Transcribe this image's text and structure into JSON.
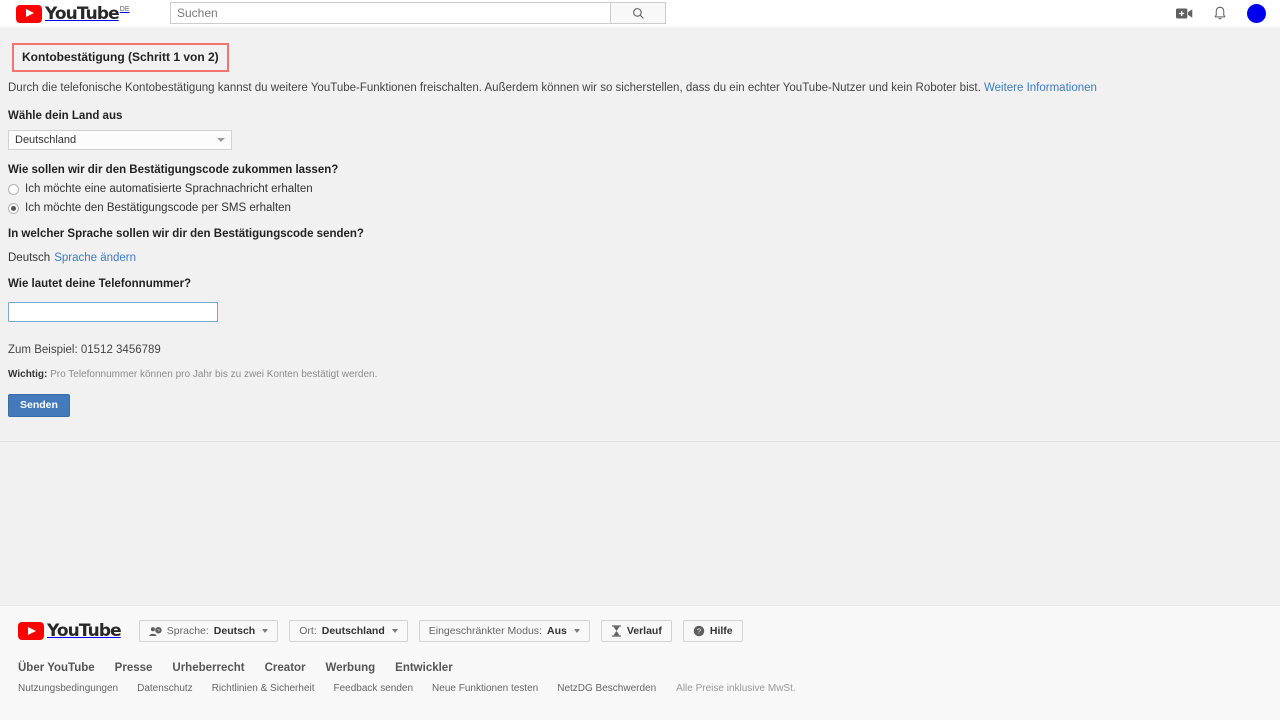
{
  "header": {
    "logo_word": "YouTube",
    "logo_country": "DE",
    "search_placeholder": "Suchen",
    "search_value": "",
    "search_icon": "search-icon",
    "create_video_icon": "video-camera-plus-icon",
    "notifications_icon": "bell-icon",
    "avatar_color": "#0000ee"
  },
  "main": {
    "title": "Kontobestätigung (Schritt 1 von 2)",
    "title_highlight_color": "#f2736f",
    "intro_text": "Durch die telefonische Kontobestätigung kannst du weitere YouTube-Funktionen freischalten. Außerdem können wir so sicherstellen, dass du ein echter YouTube-Nutzer und kein Roboter bist.",
    "intro_link": "Weitere Informationen",
    "country_label": "Wähle dein Land aus",
    "country_value": "Deutschland",
    "delivery_label": "Wie sollen wir dir den Bestätigungscode zukommen lassen?",
    "delivery_options": [
      {
        "label": "Ich möchte eine automatisierte Sprachnachricht erhalten",
        "selected": false
      },
      {
        "label": "Ich möchte den Bestätigungscode per SMS erhalten",
        "selected": true
      }
    ],
    "language_label": "In welcher Sprache sollen wir dir den Bestätigungscode senden?",
    "language_value": "Deutsch",
    "language_change_link": "Sprache ändern",
    "phone_label": "Wie lautet deine Telefonnummer?",
    "phone_value": "",
    "phone_placeholder": "",
    "example_text": "Zum Beispiel: 01512 3456789",
    "important_prefix": "Wichtig:",
    "important_text": " Pro Telefonnummer können pro Jahr bis zu zwei Konten bestätigt werden.",
    "submit_label": "Senden",
    "submit_color": "#4479ba"
  },
  "footer": {
    "logo_word": "YouTube",
    "chips": [
      {
        "icon": "person-question-icon",
        "prefix": "Sprache: ",
        "value": "Deutsch",
        "caret": true
      },
      {
        "icon": "",
        "prefix": "Ort: ",
        "value": "Deutschland",
        "caret": true
      },
      {
        "icon": "",
        "prefix": "Eingeschränkter Modus: ",
        "value": "Aus",
        "caret": true
      },
      {
        "icon": "hourglass-icon",
        "prefix": "",
        "value": "Verlauf",
        "caret": false
      },
      {
        "icon": "question-circle-icon",
        "prefix": "",
        "value": "Hilfe",
        "caret": false
      }
    ],
    "links": [
      "Über YouTube",
      "Presse",
      "Urheberrecht",
      "Creator",
      "Werbung",
      "Entwickler"
    ],
    "sublinks": [
      "Nutzungsbedingungen",
      "Datenschutz",
      "Richtlinien & Sicherheit",
      "Feedback senden",
      "Neue Funktionen testen",
      "NetzDG Beschwerden"
    ],
    "note": "Alle Preise inklusive MwSt."
  }
}
